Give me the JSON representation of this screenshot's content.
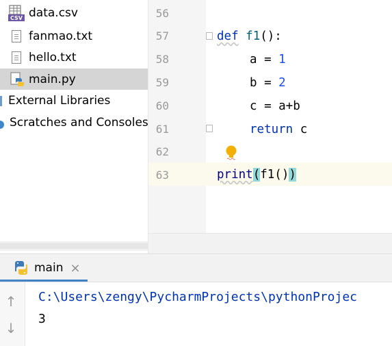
{
  "project_tree": {
    "items": [
      {
        "label": "data.csv",
        "icon": "csv-file-icon"
      },
      {
        "label": "fanmao.txt",
        "icon": "text-file-icon"
      },
      {
        "label": "hello.txt",
        "icon": "text-file-icon"
      },
      {
        "label": "main.py",
        "icon": "python-file-icon",
        "selected": true
      },
      {
        "label": "External Libraries",
        "icon": "library-icon"
      },
      {
        "label": "Scratches and Consoles",
        "icon": "scratches-icon"
      }
    ],
    "csv_badge": "CSV"
  },
  "editor": {
    "line_numbers": [
      "56",
      "57",
      "58",
      "59",
      "60",
      "61",
      "62",
      "63"
    ],
    "current_line": "63",
    "code": {
      "line57": {
        "kw": "def",
        "fn": "f1",
        "rest": "():"
      },
      "line58": {
        "var": "a",
        "op": " = ",
        "num": "1"
      },
      "line59": {
        "var": "b",
        "op": " = ",
        "num": "2"
      },
      "line60": {
        "text": "c = a+b"
      },
      "line61": {
        "kw": "return",
        "rest": " c"
      },
      "line63": {
        "builtin": "print",
        "open": "(",
        "inner": "f1()",
        "close": ")"
      }
    },
    "colors": {
      "keyword": "#0033b3",
      "number": "#1750eb",
      "builtin": "#000080",
      "brace_highlight": "#93d9d9",
      "caret_row": "#fcfaed"
    }
  },
  "run_panel": {
    "tab_label": "main",
    "tab_close": "×",
    "toolbar": {
      "up": "↑",
      "down": "↓"
    },
    "console": [
      "C:\\Users\\zengy\\PycharmProjects\\pythonProjec",
      "3"
    ],
    "colors": {
      "command": "#0033b3",
      "output": "#000000",
      "tab_accent": "#4083c9"
    }
  }
}
